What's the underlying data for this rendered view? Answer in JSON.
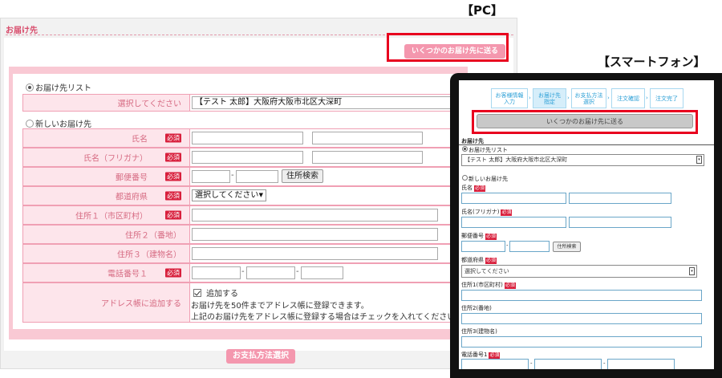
{
  "captions": {
    "pc": "【PC】",
    "sp": "【スマートフォン】"
  },
  "pc": {
    "header": "お届け先",
    "multi_button": "いくつかのお届け先に送る",
    "address_list_label": "お届け先リスト",
    "select_label": "選択してください",
    "selected_address": "【テスト 太郎】大阪府大阪市北区大深町",
    "new_address_label": "新しいお届け先",
    "required": "必須",
    "fields": {
      "name": "氏名",
      "kana": "氏名（フリガナ）",
      "zip": "郵便番号",
      "zip_search": "住所検索",
      "pref": "都道府県",
      "pref_value": "選択してください",
      "addr1": "住所１（市区町村）",
      "addr2": "住所２（番地）",
      "addr3": "住所３（建物名）",
      "tel": "電話番号１",
      "addressbook": "アドレス帳に追加する",
      "add_check": "追加する",
      "note1": "お届け先を50件までアドレス帳に登録できます。",
      "note2": "上記のお届け先をアドレス帳に登録する場合はチェックを入れてください。",
      "dash": "-"
    },
    "pay_button": "お支払方法選択"
  },
  "sp": {
    "steps": [
      {
        "l1": "お客様情報",
        "l2": "入力"
      },
      {
        "l1": "お届け先",
        "l2": "指定"
      },
      {
        "l1": "お支払方法",
        "l2": "選択"
      },
      {
        "l1": "注文確認"
      },
      {
        "l1": "注文完了"
      }
    ],
    "chevron": "›",
    "multi_button": "いくつかのお届け先に送る",
    "header": "お届け先",
    "address_list_label": "お届け先リスト",
    "selected_address": "【テスト 太郎】大阪府大阪市北区大深町",
    "new_address_label": "新しいお届け先",
    "required": "必須",
    "name": "氏名",
    "kana": "氏名(フリガナ)",
    "zip": "郵便番号",
    "zip_search": "住所検索",
    "pref": "都道府県",
    "pref_value": "選択してください",
    "addr1": "住所1(市区町村)",
    "addr2": "住所2(番地)",
    "addr3": "住所3(建物名)",
    "tel": "電話番号1",
    "dash": "-",
    "arrow": "▾"
  },
  "arrow_down": "▼",
  "colors": {
    "accent_pink": "#f497ae",
    "highlight_red": "#e8001e",
    "required_red": "#d81f3c",
    "step_blue": "#2b9fd6"
  }
}
